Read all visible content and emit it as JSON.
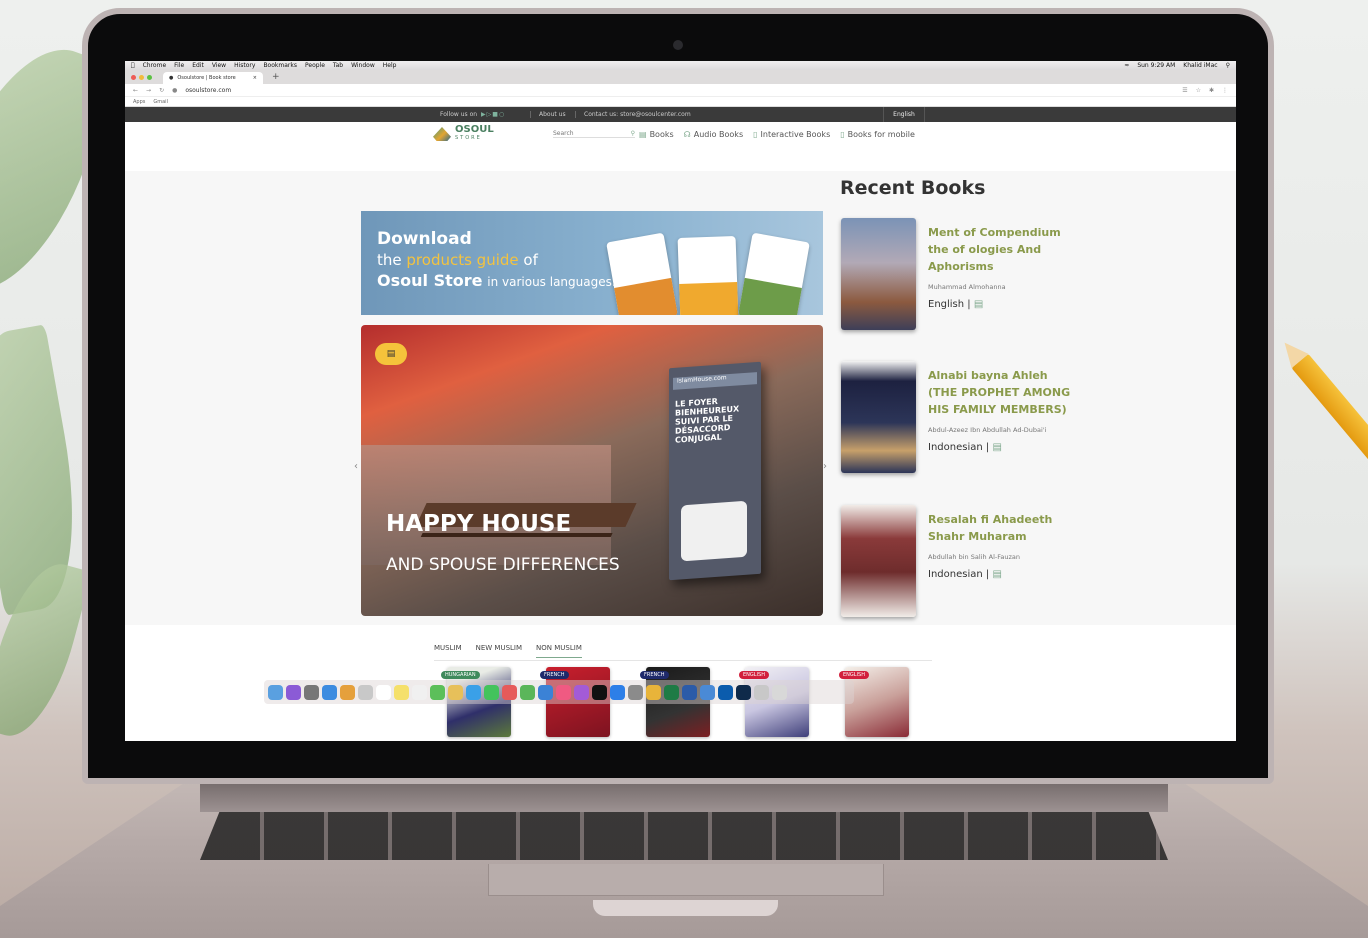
{
  "mac_menu": {
    "items": [
      "Chrome",
      "File",
      "Edit",
      "View",
      "History",
      "Bookmarks",
      "People",
      "Tab",
      "Window",
      "Help"
    ],
    "time": "Sun 9:29 AM",
    "user": "Khalid iMac"
  },
  "browser": {
    "tab_title": "Osoulstore | Book store",
    "url": "osoulstore.com",
    "bookmarks": [
      "Apps",
      "Gmail"
    ]
  },
  "top_bar": {
    "follow": "Follow us on",
    "about": "About us",
    "contact": "Contact us: store@osoulcenter.com",
    "language": "English"
  },
  "nav": {
    "logo_main": "OSOUL",
    "logo_sub": "STORE",
    "search_placeholder": "Search",
    "links": [
      "Books",
      "Audio Books",
      "Interactive Books",
      "Books for mobile"
    ]
  },
  "download_banner": {
    "line1": "Download",
    "line2_pre": "the",
    "line2_highlight": "products guide",
    "line2_post": "of",
    "line3_brand": "Osoul Store",
    "line3_rest": "in various languages."
  },
  "slide": {
    "title": "HAPPY HOUSE",
    "subtitle": "AND SPOUSE DIFFERENCES",
    "book_header": "IslamHouse.com",
    "book_title": "LE FOYER BIENHEUREUX SUIVI PAR LE DÉSACCORD CONJUGAL"
  },
  "recent": {
    "heading": "Recent Books",
    "books": [
      {
        "title": "Ment of Compendium the of ologies And Aphorisms",
        "author": "Muhammad Almohanna",
        "language": "English |"
      },
      {
        "title": "Alnabi bayna Ahleh (THE PROPHET AMONG HIS FAMILY MEMBERS)",
        "author": "Abdul-Azeez Ibn Abdullah Ad-Dubai'i",
        "language": "Indonesian |"
      },
      {
        "title": "Resalah fi Ahadeeth Shahr Muharam",
        "author": "Abdullah bin Salih Al-Fauzan",
        "language": "Indonesian |"
      }
    ]
  },
  "categories": {
    "tabs": [
      "MUSLIM",
      "NEW MUSLIM",
      "NON MUSLIM"
    ],
    "active": "NON MUSLIM",
    "items": [
      {
        "lang": "HUNGARIAN",
        "color": "#3f8a5c"
      },
      {
        "lang": "FRENCH",
        "color": "#1f2a6b"
      },
      {
        "lang": "FRENCH",
        "color": "#1f2a6b"
      },
      {
        "lang": "ENGLISH",
        "color": "#d21f3c"
      },
      {
        "lang": "ENGLISH",
        "color": "#d21f3c"
      }
    ]
  },
  "colors": {
    "accent": "#7fa98e",
    "title_olive": "#8a9a4b",
    "topbar": "#3a3a3a"
  }
}
